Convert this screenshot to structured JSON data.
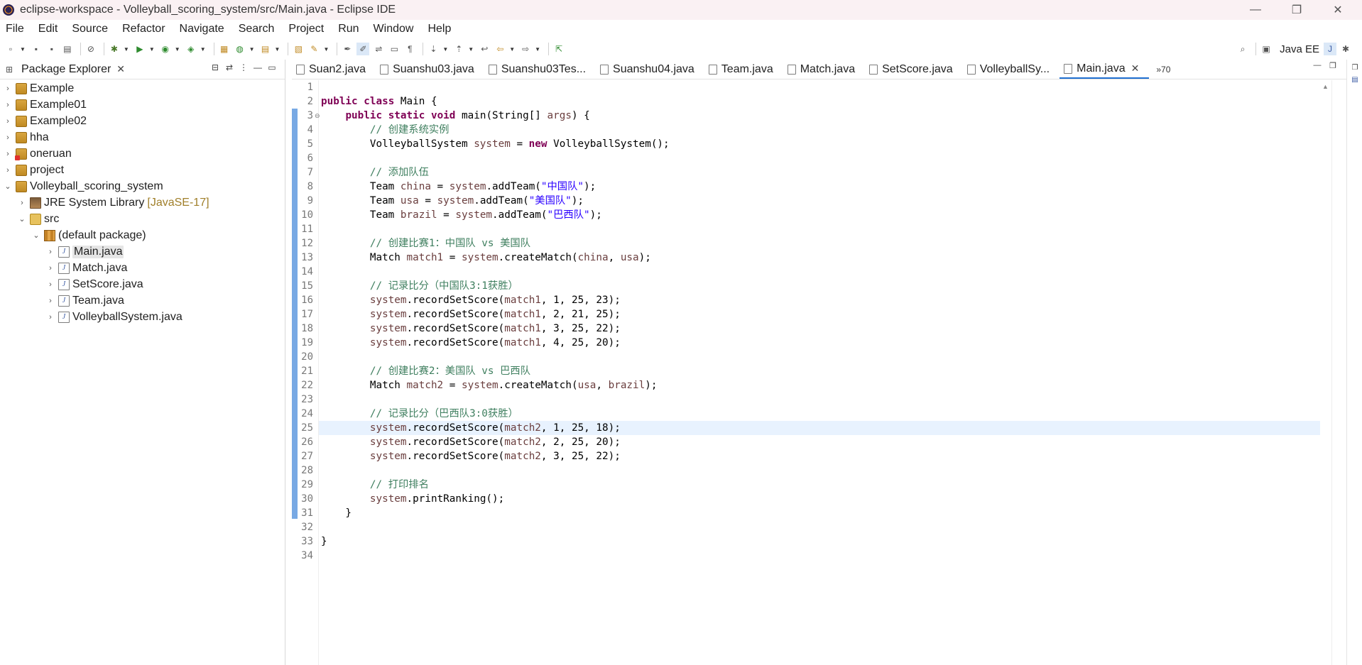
{
  "window": {
    "title": "eclipse-workspace - Volleyball_scoring_system/src/Main.java - Eclipse IDE",
    "minimize_glyph": "—",
    "restore_glyph": "❐",
    "close_glyph": "✕"
  },
  "menu": [
    "File",
    "Edit",
    "Source",
    "Refactor",
    "Navigate",
    "Search",
    "Project",
    "Run",
    "Window",
    "Help"
  ],
  "toolbar": {
    "perspective_label": "Java EE",
    "icons": [
      "new-icon",
      "save-icon",
      "save-all-icon",
      "print-icon",
      "skip-breakpoints-icon",
      "debug-icon",
      "run-icon",
      "coverage-icon",
      "external-tools-icon",
      "new-java-project-icon",
      "new-package-icon",
      "new-class-icon",
      "open-type-icon",
      "search-icon",
      "toggle-mark-occurrences-icon",
      "toggle-block-selection-icon",
      "show-whitespace-icon",
      "next-annotation-icon",
      "previous-annotation-icon",
      "last-edit-icon",
      "back-icon",
      "forward-icon",
      "pin-editor-icon"
    ]
  },
  "package_explorer": {
    "title": "Package Explorer",
    "close_glyph": "✕",
    "tree": [
      {
        "label": "Example",
        "icon": "project-icon",
        "expanded": false
      },
      {
        "label": "Example01",
        "icon": "project-icon",
        "expanded": false
      },
      {
        "label": "Example02",
        "icon": "project-icon",
        "expanded": false
      },
      {
        "label": "hha",
        "icon": "project-icon",
        "expanded": false
      },
      {
        "label": "oneruan",
        "icon": "project-error-icon",
        "expanded": false
      },
      {
        "label": "project",
        "icon": "project-icon",
        "expanded": false
      },
      {
        "label": "Volleyball_scoring_system",
        "icon": "project-icon",
        "expanded": true
      },
      {
        "label": "JRE System Library",
        "decoration": "[JavaSE-17]",
        "icon": "library-icon",
        "expanded": false
      },
      {
        "label": "src",
        "icon": "source-folder-icon",
        "expanded": true
      },
      {
        "label": "(default package)",
        "icon": "package-icon",
        "expanded": true
      },
      {
        "label": "Main.java",
        "icon": "java-file-icon",
        "expanded": false,
        "selected": true
      },
      {
        "label": "Match.java",
        "icon": "java-file-icon",
        "expanded": false
      },
      {
        "label": "SetScore.java",
        "icon": "java-file-icon",
        "expanded": false
      },
      {
        "label": "Team.java",
        "icon": "java-file-icon",
        "expanded": false
      },
      {
        "label": "VolleyballSystem.java",
        "icon": "java-file-icon",
        "expanded": false
      }
    ]
  },
  "editor": {
    "tabs": [
      {
        "label": "Suan2.java",
        "active": false
      },
      {
        "label": "Suanshu03.java",
        "active": false
      },
      {
        "label": "Suanshu03Tes...",
        "active": false
      },
      {
        "label": "Suanshu04.java",
        "active": false
      },
      {
        "label": "Team.java",
        "active": false
      },
      {
        "label": "Match.java",
        "active": false
      },
      {
        "label": "SetScore.java",
        "active": false
      },
      {
        "label": "VolleyballSy...",
        "active": false
      },
      {
        "label": "Main.java",
        "active": true
      }
    ],
    "overflow_label": "»70",
    "tab_close_glyph": "✕",
    "current_line": 25,
    "lines": [
      "",
      "public class Main {",
      "    public static void main(String[] args) {",
      "        // 创建系统实例",
      "        VolleyballSystem system = new VolleyballSystem();",
      "",
      "        // 添加队伍",
      "        Team china = system.addTeam(\"中国队\");",
      "        Team usa = system.addTeam(\"美国队\");",
      "        Team brazil = system.addTeam(\"巴西队\");",
      "",
      "        // 创建比赛1：中国队 vs 美国队",
      "        Match match1 = system.createMatch(china, usa);",
      "",
      "        // 记录比分（中国队3:1获胜）",
      "        system.recordSetScore(match1, 1, 25, 23);",
      "        system.recordSetScore(match1, 2, 21, 25);",
      "        system.recordSetScore(match1, 3, 25, 22);",
      "        system.recordSetScore(match1, 4, 25, 20);",
      "",
      "        // 创建比赛2：美国队 vs 巴西队",
      "        Match match2 = system.createMatch(usa, brazil);",
      "",
      "        // 记录比分（巴西队3:0获胜）",
      "        system.recordSetScore(match2, 1, 25, 18);",
      "        system.recordSetScore(match2, 2, 25, 20);",
      "        system.recordSetScore(match2, 3, 25, 22);",
      "",
      "        // 打印排名",
      "        system.printRanking();",
      "    }",
      "",
      "}",
      ""
    ]
  },
  "colors": {
    "keyword": "#7f0055",
    "comment": "#3f7f5f",
    "string": "#2a00ff",
    "variable": "#6a3e3e",
    "current_line": "#e8f2fe",
    "change_ruler": "#78a9e4"
  }
}
